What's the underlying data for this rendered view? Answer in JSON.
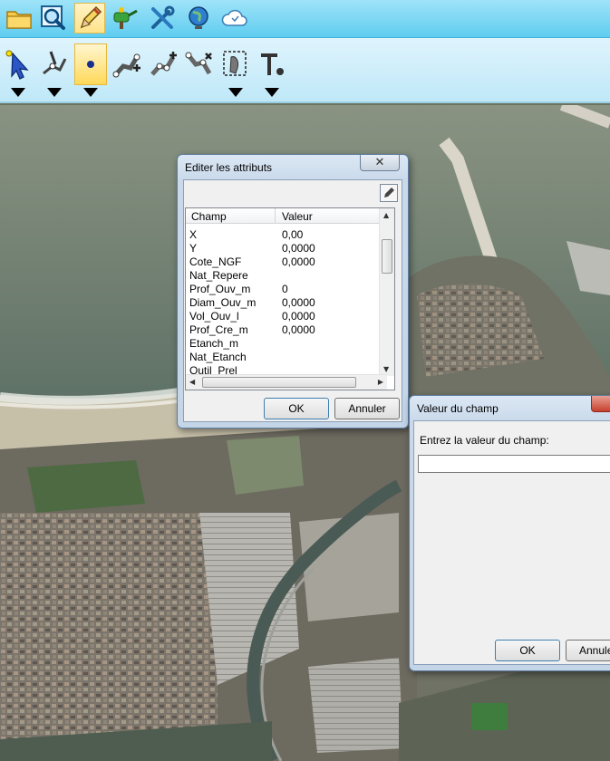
{
  "toolbar_top": {
    "buttons": [
      "folder-icon",
      "zoom-icon",
      "edit-pencil-icon",
      "watering-tool-icon",
      "tools-icon",
      "globe-icon",
      "cloud-icon"
    ]
  },
  "toolbar_tools": {
    "buttons": [
      "select-arrow-icon",
      "edit-vertex-icon",
      "add-point-icon",
      "add-line-icon",
      "add-polyline-icon",
      "add-polygon-icon",
      "select-area-icon",
      "text-tool-icon"
    ],
    "active": "add-point-icon"
  },
  "attr_dialog": {
    "title": "Editer les attributs",
    "col_field": "Champ",
    "col_value": "Valeur",
    "rows": [
      {
        "field": "X",
        "value": "0,00"
      },
      {
        "field": "Y",
        "value": "0,0000"
      },
      {
        "field": "Cote_NGF",
        "value": "0,0000"
      },
      {
        "field": "Nat_Repere",
        "value": ""
      },
      {
        "field": "Prof_Ouv_m",
        "value": "0"
      },
      {
        "field": "Diam_Ouv_m",
        "value": "0,0000"
      },
      {
        "field": "Vol_Ouv_l",
        "value": "0,0000"
      },
      {
        "field": "Prof_Cre_m",
        "value": "0,0000"
      },
      {
        "field": "Etanch_m",
        "value": ""
      },
      {
        "field": "Nat_Etanch",
        "value": ""
      },
      {
        "field": "Outil_Prel",
        "value": ""
      }
    ],
    "ok_label": "OK",
    "cancel_label": "Annuler",
    "close_glyph": "✕"
  },
  "value_dialog": {
    "title": "Valeur du champ",
    "prompt": "Entrez la valeur du champ:",
    "input_value": "",
    "ok_label": "OK",
    "cancel_label": "Annuler"
  },
  "colors": {
    "toolbar": "#5fcdf0",
    "toolbar_light": "#bfe8f8",
    "active_tool": "#ffd95a",
    "sea": "#5b7065",
    "sand": "#c9c2ac"
  }
}
